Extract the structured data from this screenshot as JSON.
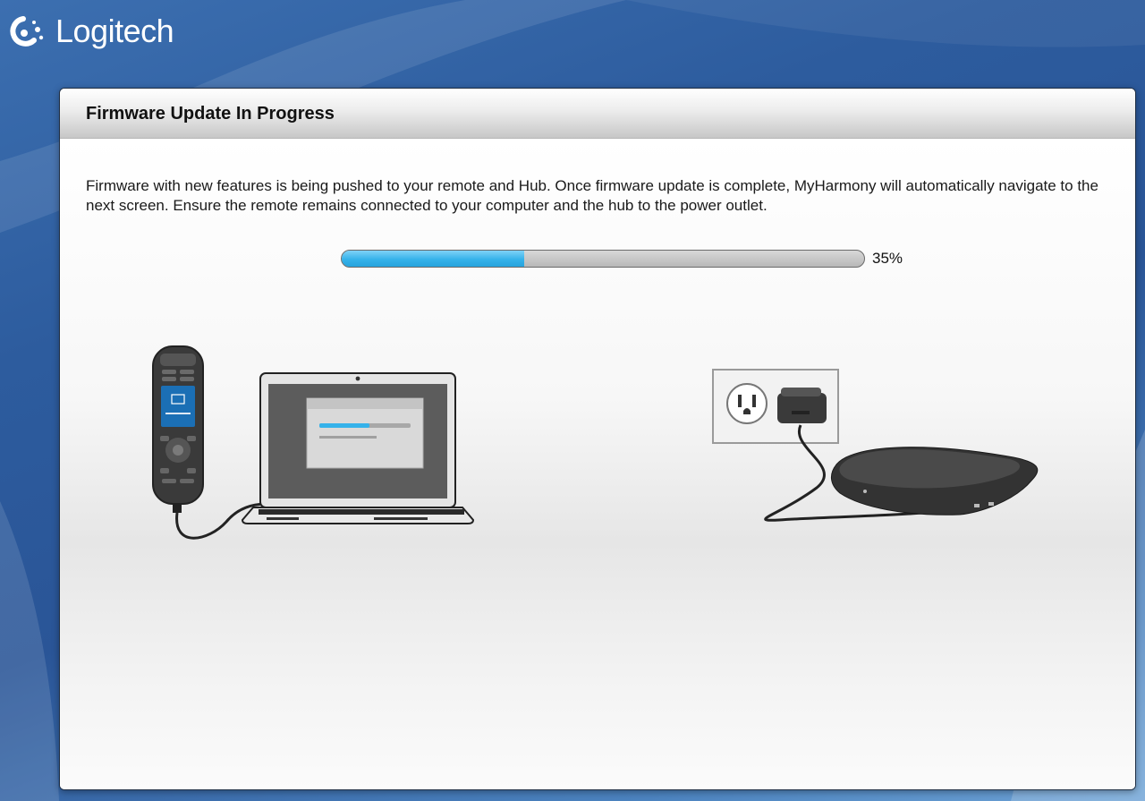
{
  "brand": {
    "name": "Logitech"
  },
  "dialog": {
    "title": "Firmware Update In Progress",
    "description": "Firmware with new features is being pushed to your remote and Hub. Once firmware update is complete, MyHarmony will automatically navigate to the next screen. Ensure the remote remains connected to your computer and the hub to the power outlet.",
    "progress": {
      "value": 0.35,
      "label": "35%"
    }
  },
  "colors": {
    "accent": "#35b2ea",
    "background": "#2d5c9e"
  },
  "icons": {
    "logo": "logitech-logo-icon",
    "remote": "harmony-remote-icon",
    "laptop": "laptop-icon",
    "outlet": "power-outlet-icon",
    "hub": "harmony-hub-icon"
  }
}
